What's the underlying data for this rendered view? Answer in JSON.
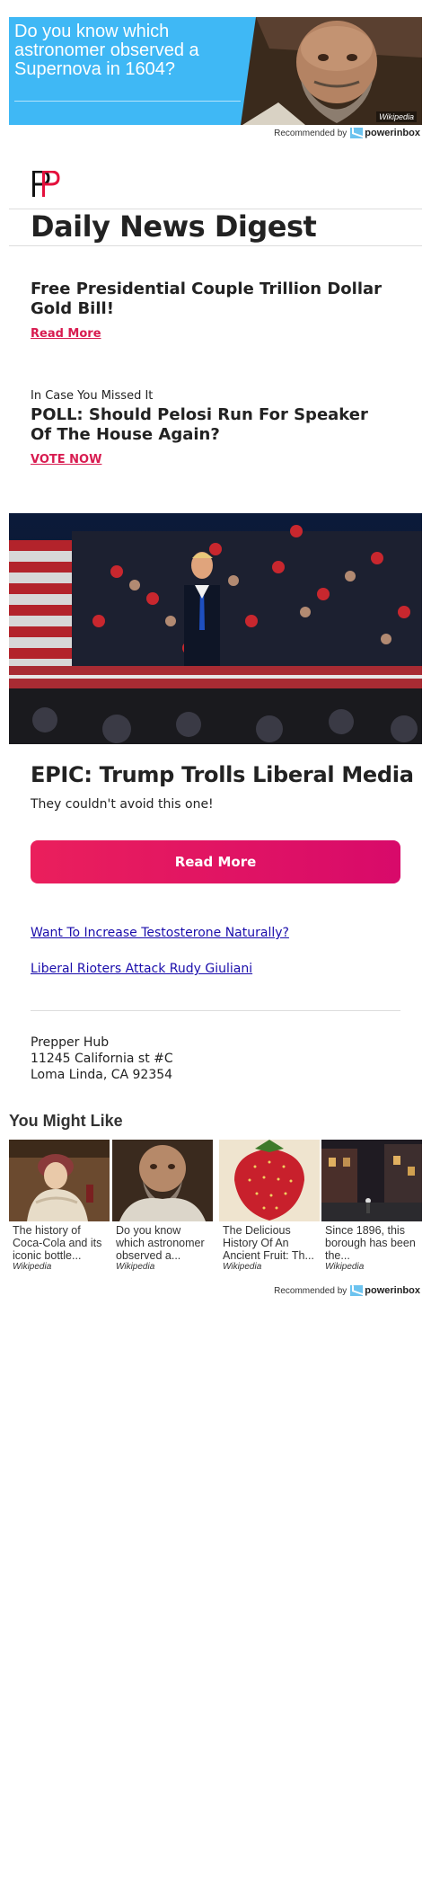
{
  "top_ad": {
    "text": "Do you know which astronomer observed a Supernova in 1604?",
    "source": "Wikipedia",
    "recommended_by": "Recommended by",
    "brand": "powerinbox"
  },
  "header": {
    "title": "Daily News Digest"
  },
  "story1": {
    "headline": "Free Presidential Couple Trillion Dollar Gold Bill!",
    "link": "Read More"
  },
  "story2": {
    "kicker": "In Case You Missed It",
    "headline": "POLL: Should Pelosi Run For Speaker Of The House Again?",
    "link": "VOTE NOW"
  },
  "feature": {
    "title": "EPIC: Trump Trolls Liberal Media",
    "subtitle": "They couldn't avoid this one!",
    "button": "Read More"
  },
  "links": [
    "Want To Increase Testosterone Naturally?",
    "Liberal Rioters Attack Rudy Giuliani"
  ],
  "address": {
    "name": "Prepper Hub",
    "street": "11245 California st #C",
    "city": "Loma Linda, CA 92354"
  },
  "you_might_like": {
    "title": "You Might Like",
    "cards": [
      {
        "text": "The history of Coca-Cola and its iconic bottle...",
        "source": "Wikipedia"
      },
      {
        "text": "Do you know which astronomer observed a...",
        "source": "Wikipedia"
      },
      {
        "text": "The Delicious History Of An Ancient Fruit: Th...",
        "source": "Wikipedia"
      },
      {
        "text": "Since 1896, this borough has been the...",
        "source": "Wikipedia"
      }
    ],
    "recommended_by": "Recommended by",
    "brand": "powerinbox"
  },
  "colors": {
    "accent_red": "#d81b50",
    "cta_gradient_start": "#ea1f5c",
    "cta_gradient_end": "#d80a6a",
    "ad_blue": "#3fb8f5",
    "link_blue": "#1a0dab"
  }
}
